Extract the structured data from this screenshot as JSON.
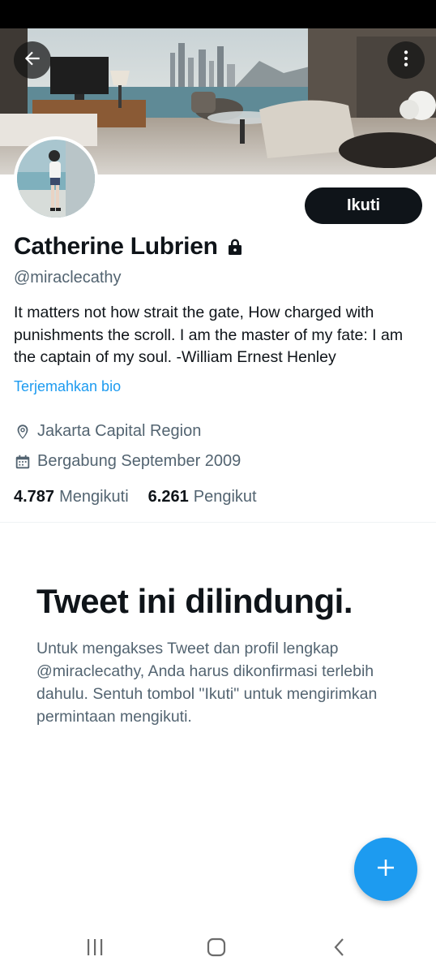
{
  "profile": {
    "display_name": "Catherine Lubrien",
    "handle": "@miraclecathy",
    "bio": "It matters not how strait the gate, How charged with punishments the scroll. I am the master of my fate: I am the captain of my soul.   -William Ernest Henley",
    "translate_bio": "Terjemahkan bio",
    "location": "Jakarta Capital Region",
    "joined": "Bergabung September 2009",
    "following_count": "4.787",
    "following_label": "Mengikuti",
    "followers_count": "6.261",
    "followers_label": "Pengikut",
    "follow_button": "Ikuti",
    "locked": true
  },
  "protected": {
    "title": "Tweet ini dilindungi.",
    "message": "Untuk mengakses Tweet dan profil lengkap @miraclecathy, Anda harus dikonfirmasi terlebih dahulu. Sentuh tombol \"Ikuti\" untuk mengirimkan permintaan mengikuti."
  },
  "icons": {
    "back": "arrow-left-icon",
    "more": "more-vertical-icon",
    "lock": "lock-icon",
    "location": "location-pin-icon",
    "calendar": "calendar-icon",
    "compose": "plus-icon",
    "nav_recent": "recent-apps-icon",
    "nav_home": "home-icon",
    "nav_back": "chevron-left-icon"
  },
  "colors": {
    "accent": "#1d9bf0",
    "text_primary": "#0f1419",
    "text_secondary": "#536471",
    "follow_button_bg": "#0f1419"
  }
}
